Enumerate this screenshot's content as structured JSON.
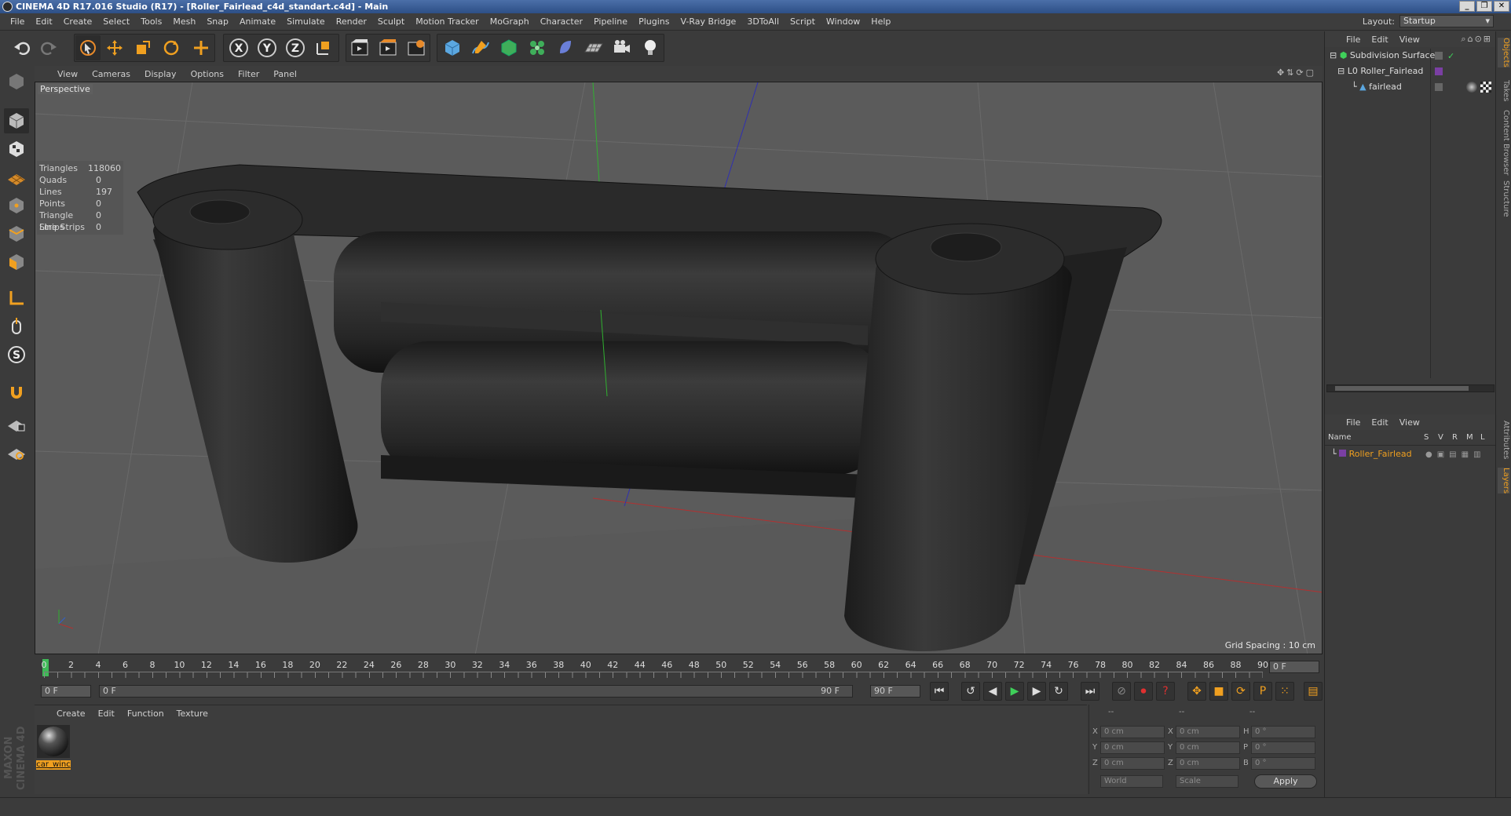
{
  "window": {
    "title": "CINEMA 4D R17.016 Studio (R17) - [Roller_Fairlead_c4d_standart.c4d] - Main",
    "min": "_",
    "max": "❐",
    "close": "✕"
  },
  "menubar": [
    "File",
    "Edit",
    "Create",
    "Select",
    "Tools",
    "Mesh",
    "Snap",
    "Animate",
    "Simulate",
    "Render",
    "Sculpt",
    "Motion Tracker",
    "MoGraph",
    "Character",
    "Pipeline",
    "Plugins",
    "V-Ray Bridge",
    "3DToAll",
    "Script",
    "Window",
    "Help"
  ],
  "layout": {
    "label": "Layout:",
    "value": "Startup"
  },
  "viewport": {
    "menu": [
      "View",
      "Cameras",
      "Display",
      "Options",
      "Filter",
      "Panel"
    ],
    "camera": "Perspective",
    "stats": [
      [
        "Triangles",
        "118060"
      ],
      [
        "Quads",
        "0"
      ],
      [
        "Lines",
        "197"
      ],
      [
        "Points",
        "0"
      ],
      [
        "Triangle Strips",
        "0"
      ],
      [
        "Line Strips",
        "0"
      ]
    ],
    "grid_spacing": "Grid Spacing : 10 cm"
  },
  "timeline": {
    "ticks": [
      "0",
      "2",
      "4",
      "6",
      "8",
      "10",
      "12",
      "14",
      "16",
      "18",
      "20",
      "22",
      "24",
      "26",
      "28",
      "30",
      "32",
      "34",
      "36",
      "38",
      "40",
      "42",
      "44",
      "46",
      "48",
      "50",
      "52",
      "54",
      "56",
      "58",
      "60",
      "62",
      "64",
      "66",
      "68",
      "70",
      "72",
      "74",
      "76",
      "78",
      "80",
      "82",
      "84",
      "86",
      "88",
      "90"
    ],
    "current_frame": "0 F",
    "start": "0 F",
    "range_start": "0 F",
    "range_end": "90 F",
    "end": "90 F"
  },
  "material_menu": [
    "Create",
    "Edit",
    "Function",
    "Texture"
  ],
  "materials": [
    {
      "name": "car_winc"
    }
  ],
  "coords": {
    "headers": [
      "--",
      "--",
      "--"
    ],
    "rows": [
      [
        "X",
        "0 cm",
        "X",
        "0 cm",
        "H",
        "0 °"
      ],
      [
        "Y",
        "0 cm",
        "Y",
        "0 cm",
        "P",
        "0 °"
      ],
      [
        "Z",
        "0 cm",
        "Z",
        "0 cm",
        "B",
        "0 °"
      ]
    ],
    "mode1": "World",
    "mode2": "Scale",
    "apply": "Apply"
  },
  "objects_menu": [
    "File",
    "Edit",
    "View"
  ],
  "objects": [
    {
      "name": "Subdivision Surface"
    },
    {
      "name": "Roller_Fairlead"
    },
    {
      "name": "fairlead"
    }
  ],
  "layers_menu": [
    "File",
    "Edit",
    "View"
  ],
  "layers_header": {
    "name": "Name",
    "cols": [
      "S",
      "V",
      "R",
      "M",
      "L"
    ]
  },
  "layers": [
    {
      "name": "Roller_Fairlead",
      "color": "#7a3fa3"
    }
  ],
  "side_tabs": [
    "Objects",
    "Takes",
    "Content Browser",
    "Structure",
    "Attributes",
    "Layers"
  ],
  "maxon": "MAXON CINEMA 4D",
  "accent": "#f0a020"
}
